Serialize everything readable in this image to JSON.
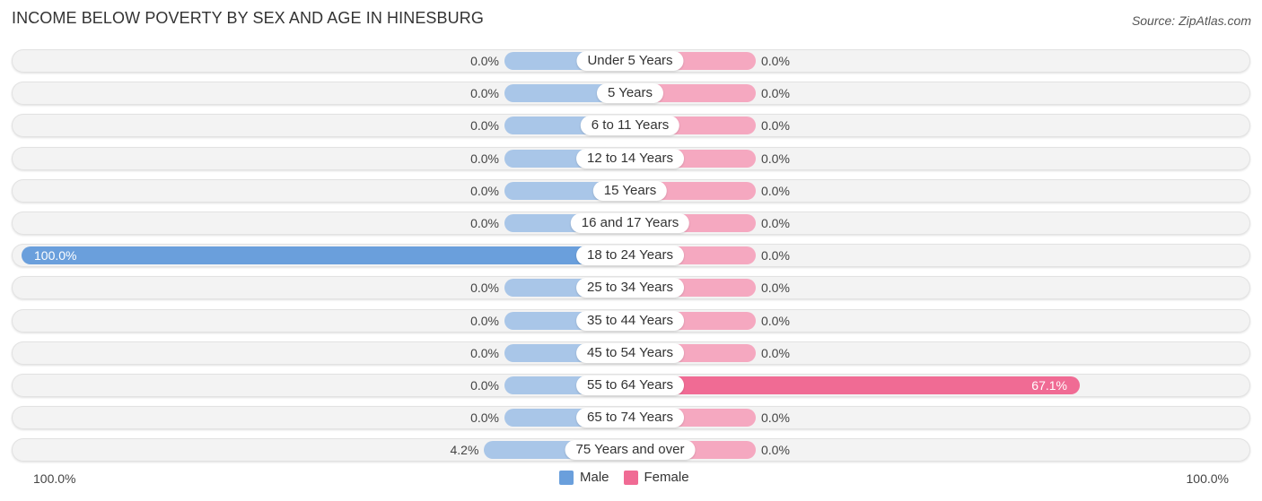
{
  "title": "INCOME BELOW POVERTY BY SEX AND AGE IN HINESBURG",
  "source": "Source: ZipAtlas.com",
  "colors": {
    "male": "#a9c6e8",
    "male_strong": "#6a9fdc",
    "female": "#f5a8c0",
    "female_strong": "#f06b94"
  },
  "chart_data": {
    "type": "bar",
    "orientation": "horizontal-diverging",
    "title": "INCOME BELOW POVERTY BY SEX AND AGE IN HINESBURG",
    "categories": [
      "Under 5 Years",
      "5 Years",
      "6 to 11 Years",
      "12 to 14 Years",
      "15 Years",
      "16 and 17 Years",
      "18 to 24 Years",
      "25 to 34 Years",
      "35 to 44 Years",
      "45 to 54 Years",
      "55 to 64 Years",
      "65 to 74 Years",
      "75 Years and over"
    ],
    "series": [
      {
        "name": "Male",
        "values": [
          0.0,
          0.0,
          0.0,
          0.0,
          0.0,
          0.0,
          100.0,
          0.0,
          0.0,
          0.0,
          0.0,
          0.0,
          4.2
        ],
        "labels": [
          "0.0%",
          "0.0%",
          "0.0%",
          "0.0%",
          "0.0%",
          "0.0%",
          "100.0%",
          "0.0%",
          "0.0%",
          "0.0%",
          "0.0%",
          "0.0%",
          "4.2%"
        ]
      },
      {
        "name": "Female",
        "values": [
          0.0,
          0.0,
          0.0,
          0.0,
          0.0,
          0.0,
          0.0,
          0.0,
          0.0,
          0.0,
          67.1,
          0.0,
          0.0
        ],
        "labels": [
          "0.0%",
          "0.0%",
          "0.0%",
          "0.0%",
          "0.0%",
          "0.0%",
          "0.0%",
          "0.0%",
          "0.0%",
          "0.0%",
          "67.1%",
          "0.0%",
          "0.0%"
        ]
      }
    ],
    "xlim": [
      -100,
      100
    ],
    "axis_labels": {
      "left": "100.0%",
      "right": "100.0%"
    },
    "legend": {
      "position": "bottom-center",
      "entries": [
        "Male",
        "Female"
      ]
    }
  }
}
